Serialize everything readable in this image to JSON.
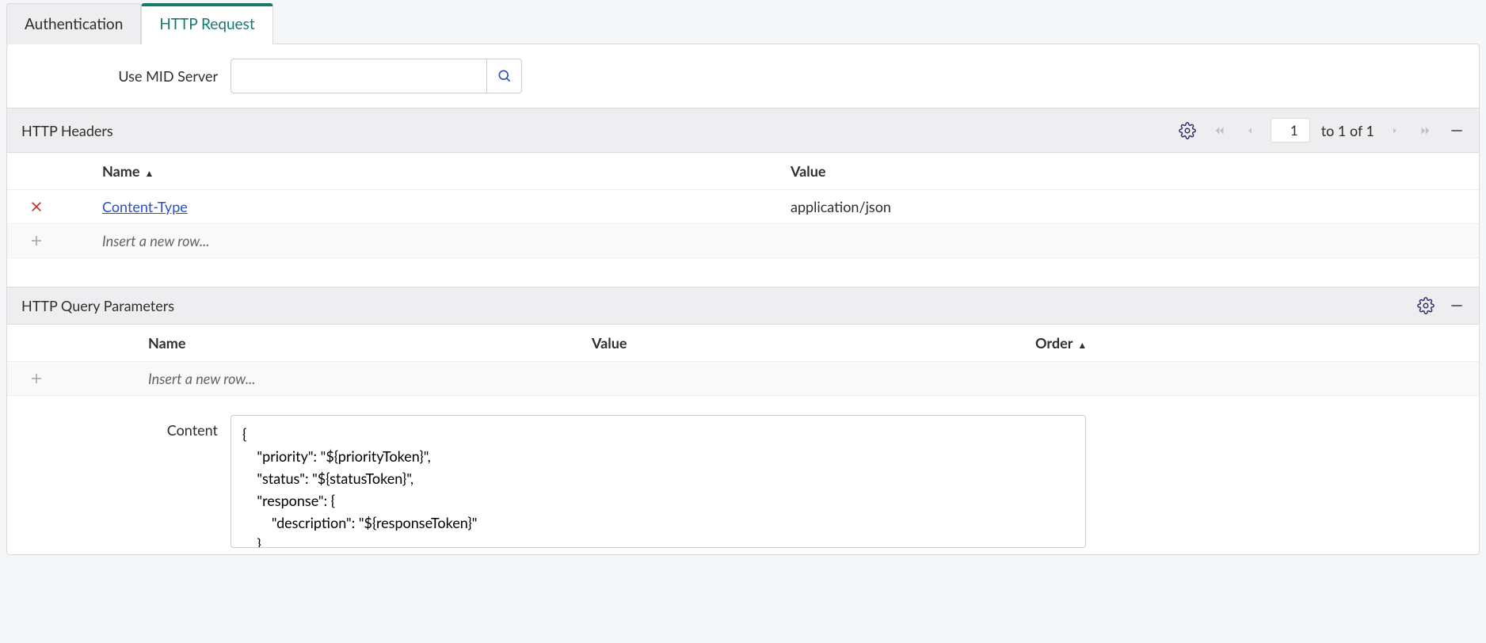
{
  "tabs": {
    "auth": "Authentication",
    "http": "HTTP Request"
  },
  "midServer": {
    "label": "Use MID Server",
    "value": ""
  },
  "headers": {
    "title": "HTTP Headers",
    "page_current": "1",
    "page_range": "to 1 of 1",
    "columns": {
      "name": "Name",
      "value": "Value"
    },
    "rows": [
      {
        "name": "Content-Type",
        "value": "application/json"
      }
    ],
    "insert_placeholder": "Insert a new row..."
  },
  "queryParams": {
    "title": "HTTP Query Parameters",
    "columns": {
      "name": "Name",
      "value": "Value",
      "order": "Order"
    },
    "insert_placeholder": "Insert a new row..."
  },
  "content": {
    "label": "Content",
    "body": "{\n    \"priority\": \"${priorityToken}\",\n    \"status\": \"${statusToken}\",\n    \"response\": {\n        \"description\": \"${responseToken}\"\n    }\n}"
  }
}
